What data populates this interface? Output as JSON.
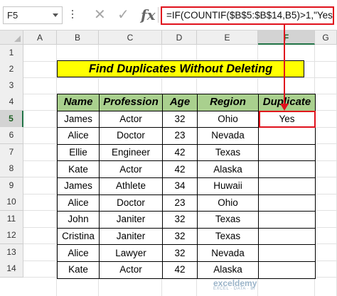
{
  "formula_bar": {
    "name_box": "F5",
    "cancel_icon": "✕",
    "confirm_icon": "✓",
    "fx_label": "fx",
    "formula": "=IF(COUNTIF($B$5:$B$14,B5)>1,\"Yes\",\"\")"
  },
  "columns": [
    "A",
    "B",
    "C",
    "D",
    "E",
    "F",
    "G"
  ],
  "rows": [
    "1",
    "2",
    "3",
    "4",
    "5",
    "6",
    "7",
    "8",
    "9",
    "10",
    "11",
    "12",
    "13",
    "14"
  ],
  "selected_cell": "F5",
  "title": "Find Duplicates Without Deleting",
  "table": {
    "headers": [
      "Name",
      "Profession",
      "Age",
      "Region",
      "Duplicate"
    ],
    "rows": [
      [
        "James",
        "Actor",
        "32",
        "Ohio",
        "Yes"
      ],
      [
        "Alice",
        "Doctor",
        "23",
        "Nevada",
        ""
      ],
      [
        "Ellie",
        "Engineer",
        "42",
        "Texas",
        ""
      ],
      [
        "Kate",
        "Actor",
        "42",
        "Alaska",
        ""
      ],
      [
        "James",
        "Athlete",
        "34",
        "Huwaii",
        ""
      ],
      [
        "Alice",
        "Doctor",
        "23",
        "Ohio",
        ""
      ],
      [
        "John",
        "Janiter",
        "32",
        "Texas",
        ""
      ],
      [
        "Cristina",
        "Janiter",
        "32",
        "Texas",
        ""
      ],
      [
        "Alice",
        "Lawyer",
        "32",
        "Nevada",
        ""
      ],
      [
        "Kate",
        "Actor",
        "42",
        "Alaska",
        ""
      ]
    ]
  },
  "colors": {
    "title_fill": "#ffff00",
    "header_fill": "#a9d08e",
    "highlight": "#e0111c"
  },
  "watermark": {
    "brand": "exceldemy",
    "tagline": "EXCEL · DATA · BI"
  }
}
